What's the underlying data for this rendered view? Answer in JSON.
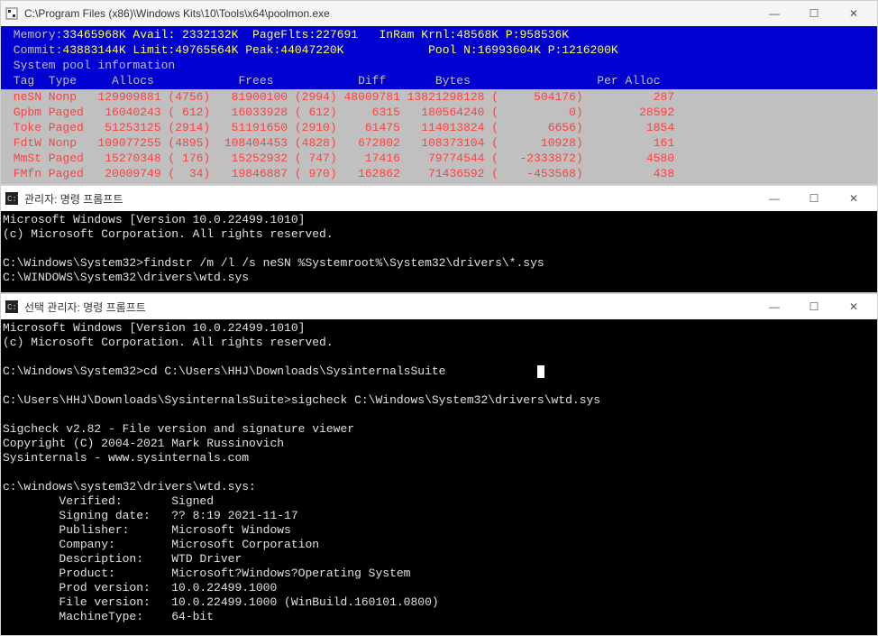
{
  "win1": {
    "title": "C:\\Program Files (x86)\\Windows Kits\\10\\Tools\\x64\\poolmon.exe",
    "header_line1_pre": " Memory:",
    "header_line1_vals": "33465968K Avail: 2332132K  PageFlts:227691   InRam Krnl:48568K P:958536K",
    "header_line2_pre": " Commit:",
    "header_line2_vals": "43883144K Limit:49765564K Peak:44047220K            Pool N:16993604K P:1216200K",
    "header_line3": " System pool information",
    "header_cols": " Tag  Type     Allocs            Frees            Diff       Bytes                  Per Alloc",
    "rows": [
      " neSN Nonp   129909881 (4756)   81900100 (2994) 48009781 13821298128 (     504176)          287",
      " Gpbm Paged   16040243 ( 612)   16033928 ( 612)     6315   180564240 (          0)        28592",
      " Toke Paged   51253125 (2914)   51191650 (2910)    61475   114013824 (       6656)         1854",
      " FdtW Nonp   109077255 (4895)  108404453 (4828)   672802   108373104 (      10928)          161",
      " MmSt Paged   15270348 ( 176)   15252932 ( 747)    17416    79774544 (   -2333872)         4580",
      " FMfn Paged   20009749 (  34)   19846887 ( 970)   162862    71436592 (    -453568)          438"
    ]
  },
  "win2": {
    "title": "관리자: 명령 프롬프트",
    "line1": "Microsoft Windows [Version 10.0.22499.1010]",
    "line2": "(c) Microsoft Corporation. All rights reserved.",
    "blank": "",
    "line3": "C:\\Windows\\System32>findstr /m /l /s neSN %Systemroot%\\System32\\drivers\\*.sys",
    "line4": "C:\\WINDOWS\\System32\\drivers\\wtd.sys"
  },
  "win3": {
    "title": "선택 관리자: 명령 프롬프트",
    "lines": [
      "Microsoft Windows [Version 10.0.22499.1010]",
      "(c) Microsoft Corporation. All rights reserved.",
      "",
      "C:\\Windows\\System32>cd C:\\Users\\HHJ\\Downloads\\SysinternalsSuite",
      "",
      "C:\\Users\\HHJ\\Downloads\\SysinternalsSuite>sigcheck C:\\Windows\\System32\\drivers\\wtd.sys",
      "",
      "Sigcheck v2.82 - File version and signature viewer",
      "Copyright (C) 2004-2021 Mark Russinovich",
      "Sysinternals - www.sysinternals.com",
      "",
      "c:\\windows\\system32\\drivers\\wtd.sys:",
      "        Verified:       Signed",
      "        Signing date:   ?? 8:19 2021-11-17",
      "        Publisher:      Microsoft Windows",
      "        Company:        Microsoft Corporation",
      "        Description:    WTD Driver",
      "        Product:        Microsoft?Windows?Operating System",
      "        Prod version:   10.0.22499.1000",
      "        File version:   10.0.22499.1000 (WinBuild.160101.0800)",
      "        MachineType:    64-bit"
    ]
  },
  "controls": {
    "min": "—",
    "max": "☐",
    "close": "✕"
  }
}
